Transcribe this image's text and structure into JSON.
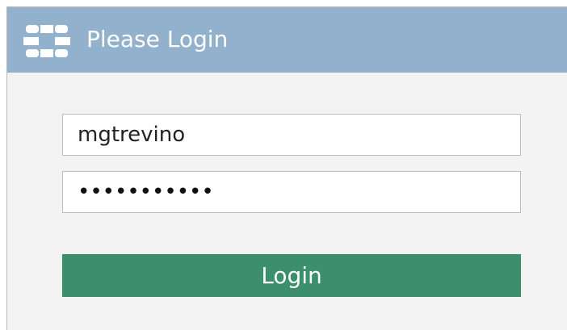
{
  "header": {
    "title": "Please Login",
    "logo_icon": "fortinet-logo-icon",
    "background_color": "#92b1cc"
  },
  "form": {
    "username_value": "mgtrevino",
    "password_value": "•••••••••••",
    "login_label": "Login",
    "login_button_color": "#3b8f6c"
  }
}
